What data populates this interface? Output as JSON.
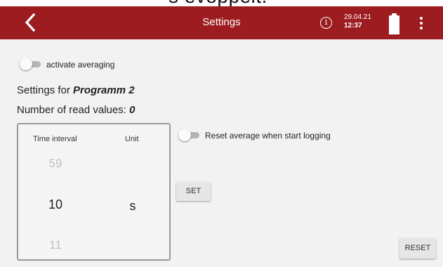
{
  "overlay_caption": "s evoppelt.",
  "header": {
    "title": "Settings",
    "info_icon": "info-icon",
    "info_glyph": "i",
    "date": "29.04.21",
    "time": "12:37",
    "battery_icon": "battery-full-icon",
    "back_icon": "chevron-left-icon",
    "menu_icon": "more-vertical-icon"
  },
  "averaging": {
    "label": "activate averaging",
    "on": false
  },
  "settings_for": {
    "prefix": "Settings for ",
    "program": "Programm 2"
  },
  "read_values": {
    "prefix": "Number of read values: ",
    "count": "0"
  },
  "picker": {
    "interval_header": "Time interval",
    "unit_header": "Unit",
    "prev_value": "59",
    "current_value": "10",
    "next_value": "11",
    "unit": "s"
  },
  "reset_average": {
    "label": "Reset average when start logging",
    "on": false
  },
  "buttons": {
    "set": "SET",
    "reset": "RESET"
  },
  "colors": {
    "appbar": "#9c1c20",
    "background": "#f2f2f2"
  }
}
